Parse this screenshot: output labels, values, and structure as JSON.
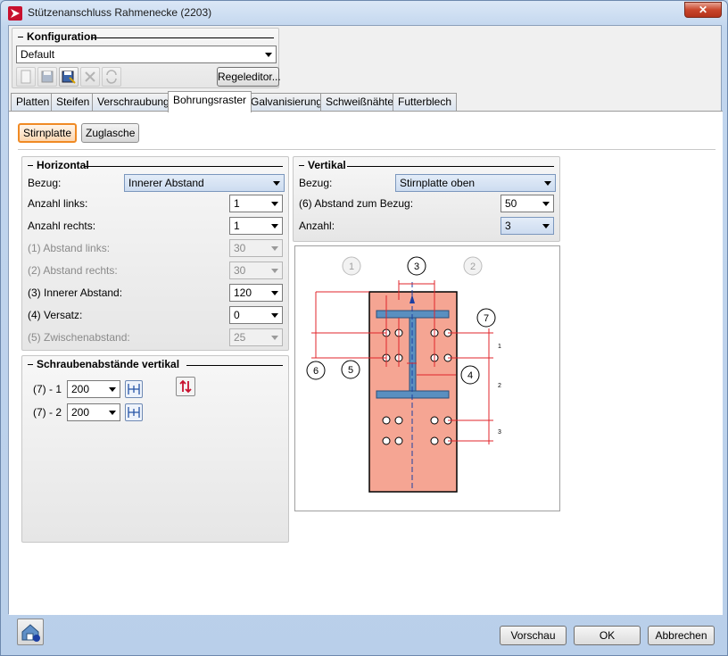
{
  "window": {
    "title": "Stützenanschluss Rahmenecke (2203)",
    "close_label": "✕"
  },
  "konfiguration": {
    "title": "Konfiguration",
    "selected": "Default",
    "regeleditor_label": "Regeleditor..."
  },
  "tabs": [
    {
      "label": "Platten"
    },
    {
      "label": "Steifen"
    },
    {
      "label": "Verschraubung"
    },
    {
      "label": "Bohrungsraster"
    },
    {
      "label": "Galvanisierung"
    },
    {
      "label": "Schweißnähte"
    },
    {
      "label": "Futterblech"
    }
  ],
  "active_tab": "Bohrungsraster",
  "subtabs": [
    {
      "label": "Stirnplatte"
    },
    {
      "label": "Zuglasche"
    }
  ],
  "horizontal": {
    "title": "Horizontal",
    "bezug_label": "Bezug:",
    "bezug_value": "Innerer Abstand",
    "anzahl_links_label": "Anzahl links:",
    "anzahl_links_value": "1",
    "anzahl_rechts_label": "Anzahl rechts:",
    "anzahl_rechts_value": "1",
    "abstand_links_label": "(1) Abstand links:",
    "abstand_links_value": "30",
    "abstand_rechts_label": "(2) Abstand rechts:",
    "abstand_rechts_value": "30",
    "innerer_abstand_label": "(3) Innerer Abstand:",
    "innerer_abstand_value": "120",
    "versatz_label": "(4) Versatz:",
    "versatz_value": "0",
    "zwischenabstand_label": "(5) Zwischenabstand:",
    "zwischenabstand_value": "25"
  },
  "vertikal": {
    "title": "Vertikal",
    "bezug_label": "Bezug:",
    "bezug_value": "Stirnplatte oben",
    "abstand_label": "(6) Abstand zum Bezug:",
    "abstand_value": "50",
    "anzahl_label": "Anzahl:",
    "anzahl_value": "3"
  },
  "schrauben": {
    "title": "Schraubenabstände vertikal",
    "rows": [
      {
        "label": "(7) - 1",
        "value": "200"
      },
      {
        "label": "(7) - 2",
        "value": "200"
      }
    ]
  },
  "diagram": {
    "callouts": [
      "1",
      "2",
      "3",
      "4",
      "5",
      "6",
      "7"
    ],
    "row_labels": [
      "1",
      "2",
      "3"
    ]
  },
  "footer": {
    "vorschau_label": "Vorschau",
    "ok_label": "OK",
    "abbrechen_label": "Abbrechen"
  }
}
